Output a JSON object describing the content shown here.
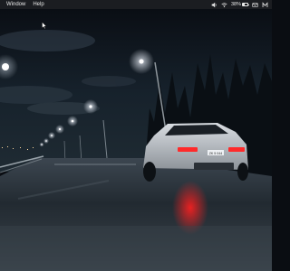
{
  "menubar": {
    "items": [
      {
        "label": "Window"
      },
      {
        "label": "Help"
      }
    ],
    "status": {
      "volume_icon": "speaker-icon",
      "wifi_icon": "wifi-icon",
      "battery_percent": "38%",
      "battery_level": 0.38,
      "mail_icon": "mail-icon",
      "app_icon": "m-logo-icon"
    }
  },
  "desktop": {
    "wallpaper": "night-road-car-wallpaper",
    "cursor_icon": "mouse-pointer-icon",
    "car_plate": "ZK 5 044"
  },
  "colors": {
    "menubar_bg": "#1b1d21",
    "sky": "#0d1219",
    "tail_light": "#ff2a2a"
  }
}
